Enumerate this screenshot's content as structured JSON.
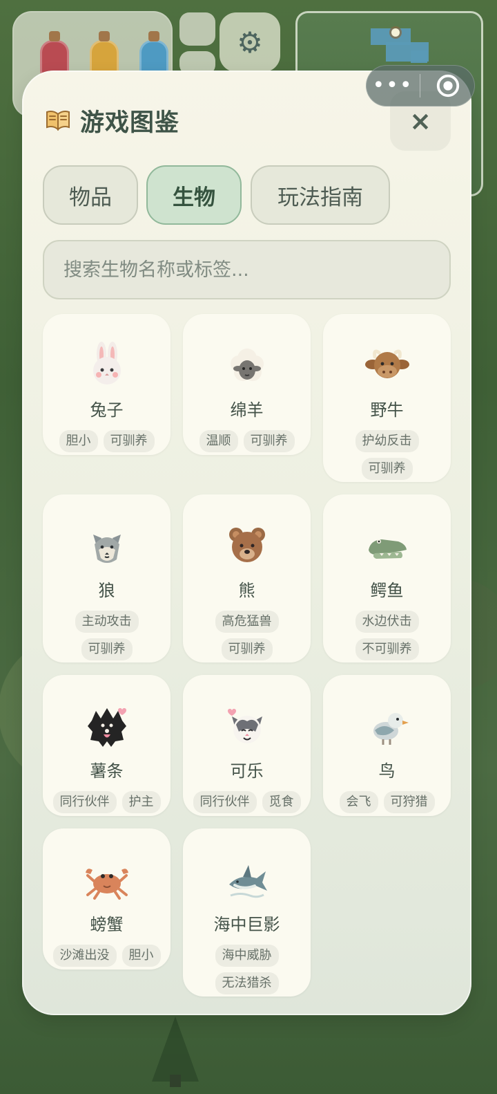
{
  "topbar": {
    "settings_icon": "gear-icon",
    "more_icon": "more-icon",
    "target_icon": "target-icon"
  },
  "panel": {
    "title": "游戏图鉴",
    "close_label": "×"
  },
  "tabs": [
    {
      "label": "物品",
      "active": false
    },
    {
      "label": "生物",
      "active": true
    },
    {
      "label": "玩法指南",
      "active": false
    }
  ],
  "search": {
    "placeholder": "搜索生物名称或标签...",
    "value": ""
  },
  "creatures": [
    {
      "name": "兔子",
      "icon": "rabbit-icon",
      "tags": [
        "胆小",
        "可驯养"
      ]
    },
    {
      "name": "绵羊",
      "icon": "sheep-icon",
      "tags": [
        "温顺",
        "可驯养"
      ]
    },
    {
      "name": "野牛",
      "icon": "bison-icon",
      "tags": [
        "护幼反击",
        "可驯养"
      ]
    },
    {
      "name": "狼",
      "icon": "wolf-icon",
      "tags": [
        "主动攻击",
        "可驯养"
      ]
    },
    {
      "name": "熊",
      "icon": "bear-icon",
      "tags": [
        "高危猛兽",
        "可驯养"
      ]
    },
    {
      "name": "鳄鱼",
      "icon": "crocodile-icon",
      "tags": [
        "水边伏击",
        "不可驯养"
      ]
    },
    {
      "name": "薯条",
      "icon": "dog-icon",
      "tags": [
        "同行伙伴",
        "护主"
      ]
    },
    {
      "name": "可乐",
      "icon": "cat-icon",
      "tags": [
        "同行伙伴",
        "觅食"
      ]
    },
    {
      "name": "鸟",
      "icon": "bird-icon",
      "tags": [
        "会飞",
        "可狩猎"
      ]
    },
    {
      "name": "螃蟹",
      "icon": "crab-icon",
      "tags": [
        "沙滩出没",
        "胆小"
      ]
    },
    {
      "name": "海中巨影",
      "icon": "shark-icon",
      "tags": [
        "海中威胁",
        "无法猎杀"
      ]
    }
  ]
}
